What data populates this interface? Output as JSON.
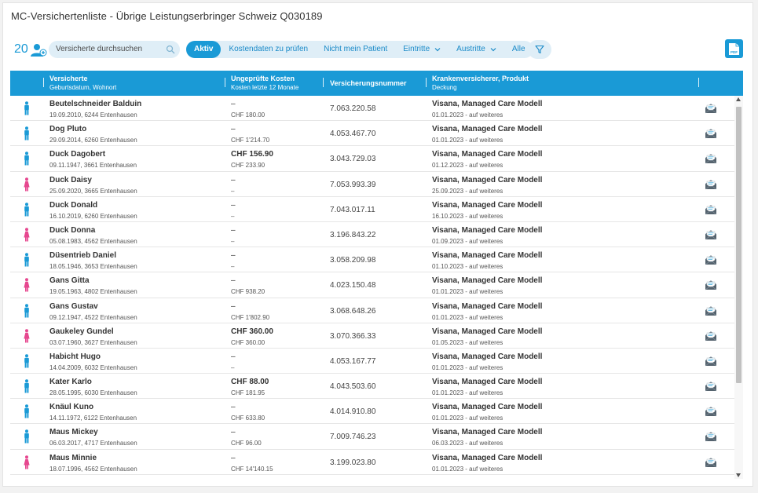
{
  "title": "MC-Versichertenliste - Übrige Leistungserbringer Schweiz Q030189",
  "toolbar": {
    "count": "20",
    "search_placeholder": "Versicherte durchsuchen",
    "tabs": [
      {
        "label": "Aktiv",
        "active": true,
        "dropdown": false
      },
      {
        "label": "Kostendaten zu prüfen",
        "active": false,
        "dropdown": false
      },
      {
        "label": "Nicht mein Patient",
        "active": false,
        "dropdown": false
      },
      {
        "label": "Eintritte",
        "active": false,
        "dropdown": true
      },
      {
        "label": "Austritte",
        "active": false,
        "dropdown": true
      },
      {
        "label": "Alle",
        "active": false,
        "dropdown": false
      }
    ],
    "pdf_label": "PDF"
  },
  "columns": {
    "insured": {
      "title": "Versicherte",
      "subtitle": "Geburtsdatum, Wohnort"
    },
    "costs": {
      "title": "Ungeprüfte Kosten",
      "subtitle": "Kosten letzte 12 Monate"
    },
    "number": {
      "title": "Versicherungsnummer"
    },
    "insurer": {
      "title": "Krankenversicherer, Produkt",
      "subtitle": "Deckung"
    }
  },
  "colors": {
    "accent": "#1a9ad6",
    "male": "#1a9ad6",
    "female": "#e6478f",
    "tab_bg": "#dfeef7"
  },
  "rows": [
    {
      "gender": "male",
      "name": "Beutelschneider Balduin",
      "details": "19.09.2010, 6244 Entenhausen",
      "unchecked": "–",
      "unchecked_bold": false,
      "costs12": "CHF 180.00",
      "number": "7.063.220.58",
      "insurer": "Visana, Managed Care Modell",
      "coverage": "01.01.2023 - auf weiteres"
    },
    {
      "gender": "male",
      "name": "Dog Pluto",
      "details": "29.09.2014, 6260 Entenhausen",
      "unchecked": "–",
      "unchecked_bold": false,
      "costs12": "CHF 1'214.70",
      "number": "4.053.467.70",
      "insurer": "Visana, Managed Care Modell",
      "coverage": "01.01.2023 - auf weiteres"
    },
    {
      "gender": "male",
      "name": "Duck Dagobert",
      "details": "09.11.1947, 3661 Entenhausen",
      "unchecked": "CHF 156.90",
      "unchecked_bold": true,
      "costs12": "CHF 233.90",
      "number": "3.043.729.03",
      "insurer": "Visana, Managed Care Modell",
      "coverage": "01.12.2023 - auf weiteres"
    },
    {
      "gender": "female",
      "name": "Duck Daisy",
      "details": "25.09.2020, 3665 Entenhausen",
      "unchecked": "–",
      "unchecked_bold": false,
      "costs12": "–",
      "number": "7.053.993.39",
      "insurer": "Visana, Managed Care Modell",
      "coverage": "25.09.2023 - auf weiteres"
    },
    {
      "gender": "male",
      "name": "Duck Donald",
      "details": "16.10.2019, 6260 Entenhausen",
      "unchecked": "–",
      "unchecked_bold": false,
      "costs12": "–",
      "number": "7.043.017.11",
      "insurer": "Visana, Managed Care Modell",
      "coverage": "16.10.2023 - auf weiteres"
    },
    {
      "gender": "female",
      "name": "Duck Donna",
      "details": "05.08.1983, 4562 Entenhausen",
      "unchecked": "–",
      "unchecked_bold": false,
      "costs12": "–",
      "number": "3.196.843.22",
      "insurer": "Visana, Managed Care Modell",
      "coverage": "01.09.2023 - auf weiteres"
    },
    {
      "gender": "male",
      "name": "Düsentrieb Daniel",
      "details": "18.05.1946, 3653 Entenhausen",
      "unchecked": "–",
      "unchecked_bold": false,
      "costs12": "–",
      "number": "3.058.209.98",
      "insurer": "Visana, Managed Care Modell",
      "coverage": "01.10.2023 - auf weiteres"
    },
    {
      "gender": "female",
      "name": "Gans Gitta",
      "details": "19.05.1963, 4802 Entenhausen",
      "unchecked": "–",
      "unchecked_bold": false,
      "costs12": "CHF 938.20",
      "number": "4.023.150.48",
      "insurer": "Visana, Managed Care Modell",
      "coverage": "01.01.2023 - auf weiteres"
    },
    {
      "gender": "male",
      "name": "Gans Gustav",
      "details": "09.12.1947, 4522 Entenhausen",
      "unchecked": "–",
      "unchecked_bold": false,
      "costs12": "CHF 1'802.90",
      "number": "3.068.648.26",
      "insurer": "Visana, Managed Care Modell",
      "coverage": "01.01.2023 - auf weiteres"
    },
    {
      "gender": "female",
      "name": "Gaukeley Gundel",
      "details": "03.07.1960, 3627 Entenhausen",
      "unchecked": "CHF 360.00",
      "unchecked_bold": true,
      "costs12": "CHF 360.00",
      "number": "3.070.366.33",
      "insurer": "Visana, Managed Care Modell",
      "coverage": "01.05.2023 - auf weiteres"
    },
    {
      "gender": "male",
      "name": "Habicht Hugo",
      "details": "14.04.2009, 6032 Entenhausen",
      "unchecked": "–",
      "unchecked_bold": false,
      "costs12": "–",
      "number": "4.053.167.77",
      "insurer": "Visana, Managed Care Modell",
      "coverage": "01.01.2023 - auf weiteres"
    },
    {
      "gender": "male",
      "name": "Kater Karlo",
      "details": "28.05.1995, 6030 Entenhausen",
      "unchecked": "CHF 88.00",
      "unchecked_bold": true,
      "costs12": "CHF 181.95",
      "number": "4.043.503.60",
      "insurer": "Visana, Managed Care Modell",
      "coverage": "01.01.2023 - auf weiteres"
    },
    {
      "gender": "male",
      "name": "Knäul Kuno",
      "details": "14.11.1972, 6122 Entenhausen",
      "unchecked": "–",
      "unchecked_bold": false,
      "costs12": "CHF 633.80",
      "number": "4.014.910.80",
      "insurer": "Visana, Managed Care Modell",
      "coverage": "01.01.2023 - auf weiteres"
    },
    {
      "gender": "male",
      "name": "Maus Mickey",
      "details": "06.03.2017, 4717 Entenhausen",
      "unchecked": "–",
      "unchecked_bold": false,
      "costs12": "CHF 96.00",
      "number": "7.009.746.23",
      "insurer": "Visana, Managed Care Modell",
      "coverage": "06.03.2023 - auf weiteres"
    },
    {
      "gender": "female",
      "name": "Maus Minnie",
      "details": "18.07.1996, 4562 Entenhausen",
      "unchecked": "–",
      "unchecked_bold": false,
      "costs12": "CHF 14'140.15",
      "number": "3.199.023.80",
      "insurer": "Visana, Managed Care Modell",
      "coverage": "01.01.2023 - auf weiteres"
    }
  ]
}
